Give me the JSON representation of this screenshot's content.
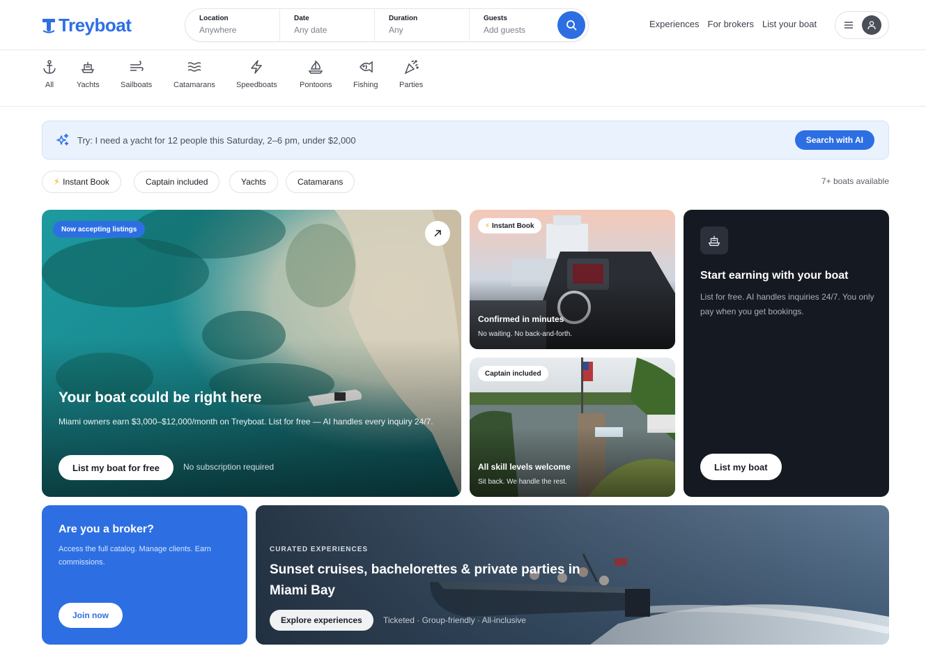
{
  "brand": {
    "name": "Treyboat",
    "accent": "#2d6fe3",
    "dark": "#151922"
  },
  "search": {
    "location": {
      "label": "Location",
      "value": "Anywhere"
    },
    "date": {
      "label": "Date",
      "value": "Any date"
    },
    "duration": {
      "label": "Duration",
      "value": "Any"
    },
    "guests": {
      "label": "Guests",
      "value": "Add guests"
    }
  },
  "nav": {
    "experiences": "Experiences",
    "brokers": "For brokers",
    "list": "List your boat"
  },
  "categories": [
    {
      "label": "All",
      "icon": "anchor-icon"
    },
    {
      "label": "Yachts",
      "icon": "yacht-icon"
    },
    {
      "label": "Sailboats",
      "icon": "wind-icon"
    },
    {
      "label": "Catamarans",
      "icon": "waves-icon"
    },
    {
      "label": "Speedboats",
      "icon": "bolt-icon"
    },
    {
      "label": "Pontoons",
      "icon": "sailboat-icon"
    },
    {
      "label": "Fishing",
      "icon": "fish-icon"
    },
    {
      "label": "Parties",
      "icon": "party-icon"
    }
  ],
  "ai": {
    "prompt": "Try: I need a yacht for 12 people this Saturday, 2–6 pm, under $2,000",
    "button": "Search with AI"
  },
  "filters": [
    "Instant Book",
    "Captain included",
    "Yachts",
    "Catamarans"
  ],
  "available": "7+ boats available",
  "hero": {
    "badge": "Now accepting listings",
    "title": "Your boat could be right here",
    "subtitle": "Miami owners earn $3,000–$12,000/month on Treyboat. List for free — AI handles every inquiry 24/7.",
    "button": "List my boat for free",
    "note": "No subscription required"
  },
  "card_instant": {
    "tag": "Instant Book",
    "title": "Confirmed in minutes",
    "subtitle": "No waiting. No back-and-forth."
  },
  "card_captain": {
    "tag": "Captain included",
    "title": "All skill levels welcome",
    "subtitle": "Sit back. We handle the rest."
  },
  "earn": {
    "title": "Start earning with your boat",
    "subtitle": "List for free. AI handles inquiries 24/7. You only pay when you get bookings.",
    "button": "List my boat"
  },
  "broker": {
    "title": "Are you a broker?",
    "subtitle": "Access the full catalog. Manage clients. Earn commissions.",
    "button": "Join now"
  },
  "experiences": {
    "kicker": "CURATED EXPERIENCES",
    "title": "Sunset cruises, bachelorettes & private parties in Miami Bay",
    "button": "Explore experiences",
    "note": "Ticketed · Group-friendly · All-inclusive"
  }
}
